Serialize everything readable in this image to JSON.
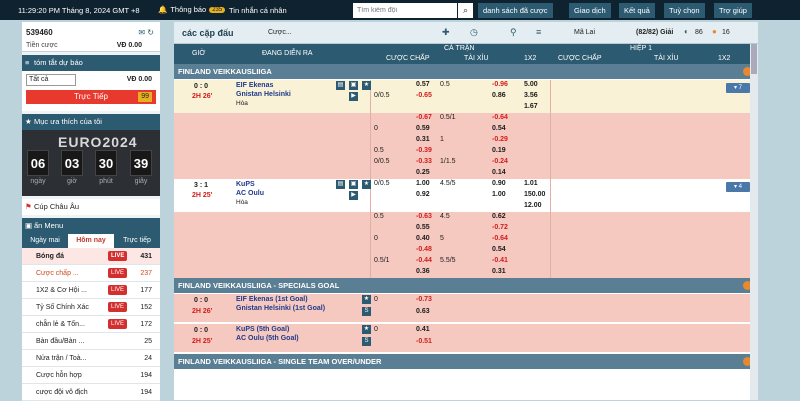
{
  "topbar": {
    "time": "11:29:20 PM Tháng 8, 2024 GMT +8",
    "notice": "Thông báo",
    "notice_badge": "235",
    "messages": "Tin nhắn cá nhân",
    "search_placeholder": "Tìm kiếm đội",
    "nav": [
      "danh sách đã cược",
      "Giao dịch",
      "Kết quả",
      "Tuỳ chọn",
      "Trợ giúp"
    ]
  },
  "account": {
    "id": "539460",
    "cash_label": "Tiền cược",
    "cash_value": "VĐ 0.00"
  },
  "predict": {
    "header": "tóm tắt dự báo",
    "select": "Tất cả",
    "value": "VĐ 0.00"
  },
  "live": {
    "label": "Trực Tiếp",
    "count": "99"
  },
  "favorites": {
    "header": "Mục ưa thích của tôi"
  },
  "euro": {
    "title": "EURO2024",
    "days": "06",
    "hours": "03",
    "minutes": "30",
    "seconds": "39",
    "l_days": "ngày",
    "l_hours": "giờ",
    "l_minutes": "phút",
    "l_seconds": "giây"
  },
  "cup": {
    "label": "Cúp Châu Âu"
  },
  "menu": {
    "header": "ẩn Menu",
    "tabs": [
      "Ngày mai",
      "Hôm nay",
      "Trực tiếp"
    ]
  },
  "sports": [
    {
      "name": "Bóng đá",
      "live": "LIVE",
      "count": "431"
    },
    {
      "name": "Cược chấp ...",
      "live": "LIVE",
      "count": "237"
    },
    {
      "name": "1X2 & Cơ Hội ...",
      "live": "LIVE",
      "count": "177"
    },
    {
      "name": "Tỷ Số Chính Xác",
      "live": "LIVE",
      "count": "152"
    },
    {
      "name": "chẵn lẻ & Tổn...",
      "live": "LIVE",
      "count": "172"
    },
    {
      "name": "Bàn đầu/Bàn ...",
      "live": "",
      "count": "25"
    },
    {
      "name": "Nửa trận / Toà...",
      "live": "",
      "count": "24"
    },
    {
      "name": "Cược hỗn hợp",
      "live": "",
      "count": "194"
    },
    {
      "name": "cược đội vô địch",
      "live": "",
      "count": "194"
    }
  ],
  "main": {
    "title": "các cặp đấu",
    "bet_select": "Cược...",
    "market": "Mã Lai",
    "games": "(82/82) Giải",
    "count86": "86",
    "count16": "16"
  },
  "columns": {
    "time": "GIỜ",
    "event": "ĐANG DIỄN RA",
    "full": "CẢ TRẬN",
    "half": "HIỆP 1",
    "handicap": "CƯỢC CHẤP",
    "ou": "TÀI XỈU",
    "x12": "1X2",
    "handicap2": "CƯỢC CHẤP",
    "ou2": "TÀI XỈU",
    "x122": "1X2"
  },
  "sections": [
    "FINLAND VEIKKAUSLIIGA",
    "FINLAND VEIKKAUSLIIGA - SPECIALS GOAL",
    "FINLAND VEIKKAUSLIIGA - SINGLE TEAM OVER/UNDER"
  ],
  "match1": {
    "score": "0 : 0",
    "time": "2H 26'",
    "home": "EIF Ekenas",
    "away": "Gnistan Helsinki",
    "draw": "Hòa",
    "more": "▾ 7",
    "rows": [
      [
        "",
        "0.57",
        "0.5",
        "-0.96",
        "5.00"
      ],
      [
        "0/0.5",
        "-0.65",
        "",
        "0.86",
        "3.56"
      ],
      [
        "",
        "",
        "",
        "",
        "1.67"
      ],
      [
        "",
        "-0.67",
        "0.5/1",
        "-0.64",
        ""
      ],
      [
        "0",
        "0.59",
        "",
        "0.54",
        ""
      ],
      [
        "",
        "0.31",
        "1",
        "-0.29",
        ""
      ],
      [
        "0.5",
        "-0.39",
        "",
        "0.19",
        ""
      ],
      [
        "0/0.5",
        "-0.33",
        "1/1.5",
        "-0.24",
        ""
      ],
      [
        "",
        "0.25",
        "",
        "0.14",
        ""
      ]
    ]
  },
  "match2": {
    "score": "3 : 1",
    "time": "2H 25'",
    "home": "KuPS",
    "away": "AC Oulu",
    "draw": "Hòa",
    "more": "▾ 4",
    "rows": [
      [
        "0/0.5",
        "1.00",
        "4.5/5",
        "0.90",
        "1.01"
      ],
      [
        "",
        "0.92",
        "",
        "1.00",
        "150.00"
      ],
      [
        "",
        "",
        "",
        "",
        "12.00"
      ],
      [
        "0.5",
        "-0.63",
        "4.5",
        "0.62",
        ""
      ],
      [
        "",
        "0.55",
        "",
        "-0.72",
        ""
      ],
      [
        "0",
        "0.40",
        "5",
        "-0.64",
        ""
      ],
      [
        "",
        "-0.48",
        "",
        "0.54",
        ""
      ],
      [
        "0.5/1",
        "-0.44",
        "5.5/5",
        "-0.41",
        ""
      ],
      [
        "",
        "0.36",
        "",
        "0.31",
        ""
      ]
    ]
  },
  "match3": {
    "score": "0 : 0",
    "time": "2H 26'",
    "home": "EIF Ekenas (1st Goal)",
    "away": "Gnistan Helsinki (1st Goal)",
    "hcp": "0",
    "o1": "-0.73",
    "o2": "0.63"
  },
  "match4": {
    "score": "0 : 0",
    "time": "2H 25'",
    "home": "KuPS (5th Goal)",
    "away": "AC Oulu (5th Goal)",
    "hcp": "0",
    "o1": "0.41",
    "o2": "-0.51"
  }
}
